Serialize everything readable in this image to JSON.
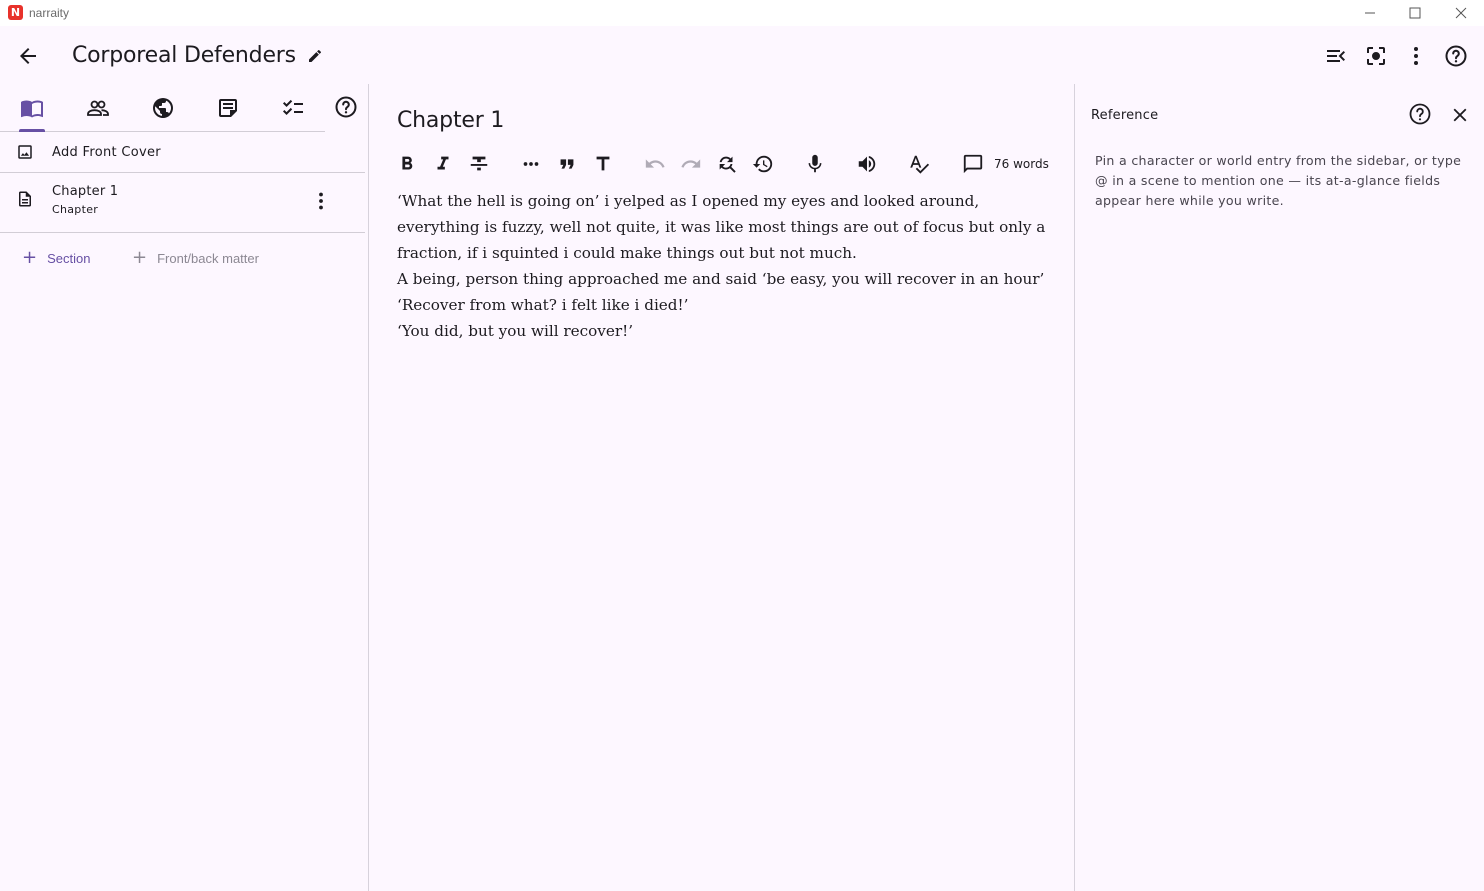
{
  "window": {
    "app_name": "narraity",
    "logo_letter": "N"
  },
  "header": {
    "book_title": "Corporeal Defenders"
  },
  "sidebar": {
    "front_cover_label": "Add Front Cover",
    "chapters": [
      {
        "title": "Chapter 1",
        "type": "Chapter"
      }
    ],
    "add_section_label": "Section",
    "add_matter_label": "Front/back matter"
  },
  "editor": {
    "chapter_title": "Chapter 1",
    "word_count": "76 words",
    "paragraphs": [
      "‘What the hell is going on’ i yelped as I opened my eyes and looked around,",
      "everything is fuzzy, well not quite, it was like most things are out of focus but only a",
      "fraction, if i squinted i could make things out but not much.",
      "A being, person thing approached me and said ‘be easy, you will recover in an hour’",
      "‘Recover from what? i felt like i died!’",
      "‘You did, but you will recover!’"
    ]
  },
  "reference": {
    "title": "Reference",
    "description": "Pin a character or world entry from the sidebar, or type @ in a scene to mention one — its at-a-glance fields appear here while you write."
  },
  "colors": {
    "background": "#fdf7ff",
    "accent": "#6750a4",
    "logo": "#e8322b",
    "divider": "#d7d2dc",
    "muted_text": "#8c8893"
  }
}
